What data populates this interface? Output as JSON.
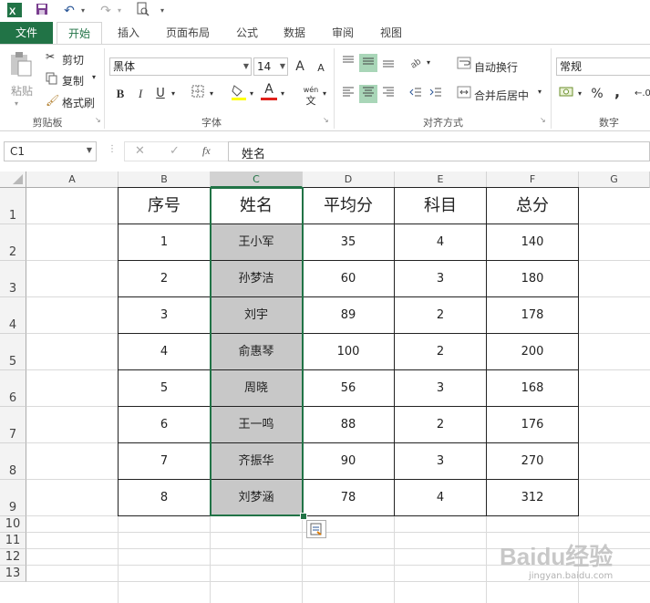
{
  "qat": {
    "app_icon": "excel-logo-icon",
    "save_icon": "save-icon",
    "undo_icon": "undo-icon",
    "redo_icon": "redo-icon",
    "preview_icon": "print-preview-icon",
    "customize_icon": "chevron-down-icon"
  },
  "tabs": [
    {
      "label": "文件"
    },
    {
      "label": "开始"
    },
    {
      "label": "插入"
    },
    {
      "label": "页面布局"
    },
    {
      "label": "公式"
    },
    {
      "label": "数据"
    },
    {
      "label": "审阅"
    },
    {
      "label": "视图"
    }
  ],
  "ribbon": {
    "clipboard": {
      "paste": "粘贴",
      "cut": "剪切",
      "copy": "复制",
      "format_painter": "格式刷",
      "label": "剪贴板"
    },
    "font": {
      "name": "黑体",
      "size": "14",
      "bold": "B",
      "italic": "I",
      "underline": "U",
      "phonetic": "wén",
      "grow": "A",
      "shrink": "A",
      "font_color": "A",
      "label": "字体"
    },
    "alignment": {
      "wrap": "自动换行",
      "merge": "合并后居中",
      "label": "对齐方式"
    },
    "number": {
      "format": "常规",
      "percent": "%",
      "comma": ",",
      "label": "数字"
    }
  },
  "formula_bar": {
    "name_box": "C1",
    "cancel": "✕",
    "enter": "✓",
    "fx": "fx",
    "content": "姓名"
  },
  "columns": [
    "A",
    "B",
    "C",
    "D",
    "E",
    "F",
    "G"
  ],
  "rows": [
    "1",
    "2",
    "3",
    "4",
    "5",
    "6",
    "7",
    "8",
    "9",
    "10",
    "11",
    "12",
    "13"
  ],
  "table": {
    "headers": [
      "序号",
      "姓名",
      "平均分",
      "科目",
      "总分"
    ],
    "rows": [
      [
        "1",
        "王小军",
        "35",
        "4",
        "140"
      ],
      [
        "2",
        "孙梦洁",
        "60",
        "3",
        "180"
      ],
      [
        "3",
        "刘宇",
        "89",
        "2",
        "178"
      ],
      [
        "4",
        "俞惠琴",
        "100",
        "2",
        "200"
      ],
      [
        "5",
        "周晓",
        "56",
        "3",
        "168"
      ],
      [
        "6",
        "王一鸣",
        "88",
        "2",
        "176"
      ],
      [
        "7",
        "齐振华",
        "90",
        "3",
        "270"
      ],
      [
        "8",
        "刘梦涵",
        "78",
        "4",
        "312"
      ]
    ]
  },
  "quick_analysis_icon": "quick-analysis-icon",
  "watermark": "Baidu经验",
  "watermark_url": "jingyan.baidu.com",
  "colors": {
    "accent": "#217346",
    "selection": "#c6c6c6",
    "highlight": "#a9d6b8"
  }
}
